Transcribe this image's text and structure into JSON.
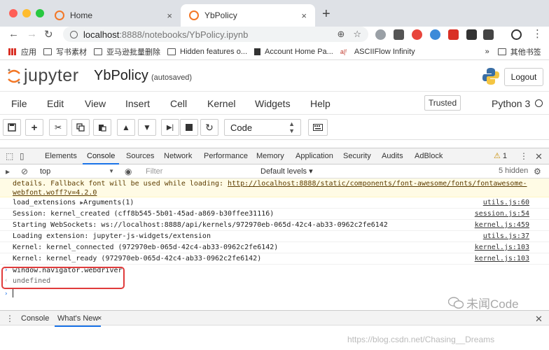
{
  "browser": {
    "tabs": [
      {
        "title": "Home",
        "close": "×"
      },
      {
        "title": "YbPolicy",
        "close": "×"
      }
    ],
    "new_tab": "+",
    "url_host": "localhost",
    "url_rest": ":8888/notebooks/YbPolicy.ipynb",
    "bookmarks": [
      "应用",
      "写书素材",
      "亚马逊批量删除",
      "Hidden features o...",
      "Account Home Pa...",
      "ASCIIFlow Infinity",
      "»",
      "其他书签"
    ],
    "colors": {
      "close": "#ff5f57",
      "minimize": "#febc2e",
      "zoom": "#28c840"
    }
  },
  "jupyter": {
    "logo_word": "jupyter",
    "notebook_name": "YbPolicy",
    "autosave_status": "(autosaved)",
    "logout": "Logout",
    "menu": [
      "File",
      "Edit",
      "View",
      "Insert",
      "Cell",
      "Kernel",
      "Widgets",
      "Help"
    ],
    "trusted": "Trusted",
    "kernel": "Python 3",
    "cell_type": "Code"
  },
  "devtools": {
    "tabs": [
      "Elements",
      "Console",
      "Sources",
      "Network",
      "Performance",
      "Memory",
      "Application",
      "Security",
      "Audits",
      "AdBlock"
    ],
    "warning_count": "1",
    "context": "top",
    "filter_placeholder": "Filter",
    "levels": "Default levels ▾",
    "hidden": "5 hidden",
    "warning_text": "details. Fallback font will be used while loading: ",
    "warning_link": "http://localhost:8888/static/components/font-awesome/fonts/fontawesome-webfont.woff?v=4.2.0",
    "logs": [
      {
        "text": "load_extensions",
        "extra": "Arguments(1)",
        "src": "utils.js:60"
      },
      {
        "text": "Session: kernel_created (cff8b545-5b01-45ad-a869-b30ffee31116)",
        "src": "session.js:54"
      },
      {
        "text": "Starting WebSockets: ws://localhost:8888/api/kernels/972970eb-065d-42c4-ab33-0962c2fe6142",
        "src": "kernel.js:459"
      },
      {
        "text": "Loading extension: jupyter-js-widgets/extension",
        "src": "utils.js:37"
      },
      {
        "text": "Kernel: kernel_connected (972970eb-065d-42c4-ab33-0962c2fe6142)",
        "src": "kernel.js:103"
      },
      {
        "text": "Kernel: kernel_ready (972970eb-065d-42c4-ab33-0962c2fe6142)",
        "src": "kernel.js:103"
      }
    ],
    "command": "window.navigator.webdriver",
    "result": "undefined",
    "drawer_tabs": [
      "Console",
      "What's New"
    ],
    "drawer_close": "×"
  },
  "watermark": "未闻Code",
  "credit": "https://blog.csdn.net/Chasing__Dreams"
}
